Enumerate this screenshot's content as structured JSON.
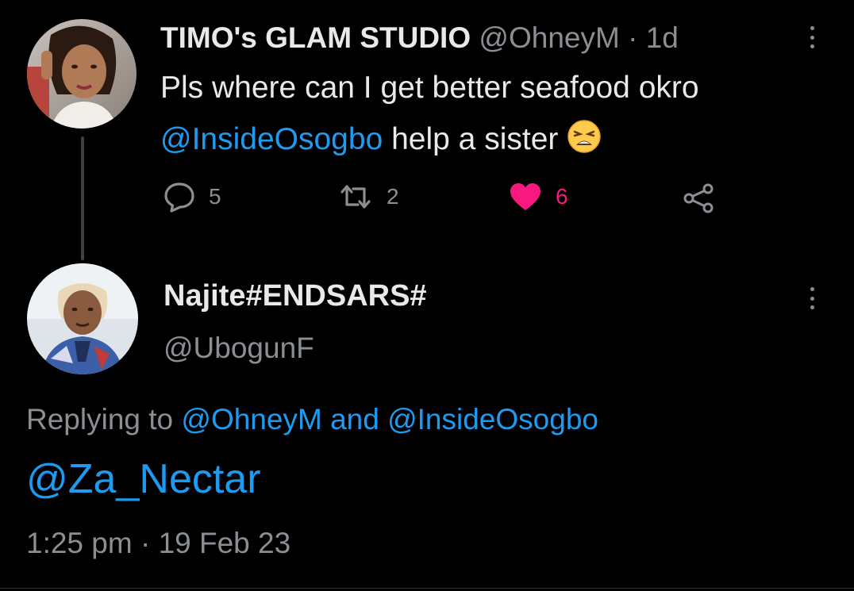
{
  "tweet": {
    "display_name": "TIMO's GLAM STUDIO",
    "handle": "@OhneyM",
    "separator": "·",
    "time_ago": "1d",
    "text_line1": "Pls where can I get better seafood okro",
    "mention": "@InsideOsogbo",
    "text_line2_rest": " help a sister ",
    "emoji": "😩",
    "reply_count": "5",
    "retweet_count": "2",
    "like_count": "6"
  },
  "reply": {
    "display_name": "Najite#ENDSARS#",
    "handle": "@UbogunF",
    "replying_prefix": "Replying to ",
    "replying_user1": "@OhneyM",
    "replying_and": " and ",
    "replying_user2": "@InsideOsogbo",
    "text_mention": "@Za_Nectar",
    "timestamp": "1:25 pm · 19 Feb 23"
  },
  "colors": {
    "background": "#000000",
    "text": "#e7e9ea",
    "muted": "#8b8f94",
    "link": "#1d9bf0",
    "like": "#f91880"
  }
}
